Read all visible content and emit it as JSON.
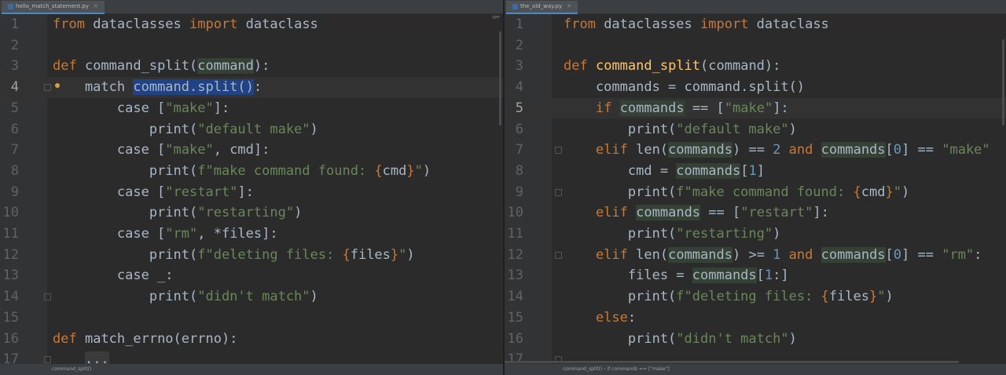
{
  "left": {
    "tab": "hello_match_statement.py",
    "off_label": "OFF",
    "breadcrumb": "command_split()",
    "lines": [
      {
        "n": "1",
        "html": "<span class=\"kw\">from</span> dataclasses <span class=\"kw\">import</span> dataclass"
      },
      {
        "n": "2",
        "html": ""
      },
      {
        "n": "3",
        "html": "<span class=\"kw\">def</span> command_split(<span class=\"hl\">command</span>):"
      },
      {
        "n": "4",
        "html": "    match <span class=\"sel\">command.split()</span>:"
      },
      {
        "n": "5",
        "html": "        case [<span class=\"str\">\"make\"</span>]:"
      },
      {
        "n": "6",
        "html": "            print(<span class=\"str\">\"default make\"</span>)"
      },
      {
        "n": "7",
        "html": "        case [<span class=\"str\">\"make\"</span>, cmd]:"
      },
      {
        "n": "8",
        "html": "            print(<span class=\"str\">f\"make command found: </span><span class=\"kw\">{</span>cmd<span class=\"kw\">}</span><span class=\"str\">\"</span>)"
      },
      {
        "n": "9",
        "html": "        case [<span class=\"str\">\"restart\"</span>]:"
      },
      {
        "n": "10",
        "html": "            print(<span class=\"str\">\"restarting\"</span>)"
      },
      {
        "n": "11",
        "html": "        case [<span class=\"str\">\"rm\"</span>, *files]:"
      },
      {
        "n": "12",
        "html": "            print(<span class=\"str\">f\"deleting files: </span><span class=\"kw\">{</span>files<span class=\"kw\">}</span><span class=\"str\">\"</span>)"
      },
      {
        "n": "13",
        "html": "        case _:"
      },
      {
        "n": "14",
        "html": "            print(<span class=\"str\">\"didn't match\"</span>)"
      },
      {
        "n": "15",
        "html": ""
      },
      {
        "n": "16",
        "html": "<span class=\"kw\">def</span> match_errno(errno):"
      },
      {
        "n": "17",
        "html": "    <span style=\"background:#3b3b3b\">...</span>"
      }
    ]
  },
  "right": {
    "tab": "the_old_way.py",
    "breadcrumb": "command_split()  ›  if commands == [\"make\"]",
    "lines": [
      {
        "n": "1",
        "html": "<span class=\"kw\">from</span> dataclasses <span class=\"kw\">import</span> dataclass"
      },
      {
        "n": "2",
        "html": ""
      },
      {
        "n": "3",
        "html": "<span class=\"kw\">def</span> <span class=\"fn\">command_split</span>(command):"
      },
      {
        "n": "4",
        "html": "    commands = command.split()"
      },
      {
        "n": "5",
        "html": "    <span class=\"kw\">if</span> <span class=\"hl\">commands</span> == [<span class=\"str\">\"make\"</span>]:"
      },
      {
        "n": "6",
        "html": "        print(<span class=\"str\">\"default make\"</span>)"
      },
      {
        "n": "7",
        "html": "    <span class=\"kw\">elif</span> len(<span class=\"hl\">commands</span>) == <span class=\"num-lit\">2</span> <span class=\"kw\">and</span> <span class=\"hl\">commands</span>[<span class=\"num-lit\">0</span>] == <span class=\"str\">\"make\"</span>"
      },
      {
        "n": "8",
        "html": "        cmd = <span class=\"hl\">commands</span>[<span class=\"num-lit\">1</span>]"
      },
      {
        "n": "9",
        "html": "        print(<span class=\"str\">f\"make command found: </span><span class=\"kw\">{</span>cmd<span class=\"kw\">}</span><span class=\"str\">\"</span>)"
      },
      {
        "n": "10",
        "html": "    <span class=\"kw\">elif</span> <span class=\"hl\">commands</span> == [<span class=\"str\">\"restart\"</span>]:"
      },
      {
        "n": "11",
        "html": "        print(<span class=\"str\">\"restarting\"</span>)"
      },
      {
        "n": "12",
        "html": "    <span class=\"kw\">elif</span> len(<span class=\"hl\">commands</span>) >= <span class=\"num-lit\">1</span> <span class=\"kw\">and</span> <span class=\"hl\">commands</span>[<span class=\"num-lit\">0</span>] == <span class=\"str\">\"rm\"</span>:"
      },
      {
        "n": "13",
        "html": "        files = <span class=\"hl\">commands</span>[<span class=\"num-lit\">1</span>:]"
      },
      {
        "n": "14",
        "html": "        print(<span class=\"str\">f\"deleting files: </span><span class=\"kw\">{</span>files<span class=\"kw\">}</span><span class=\"str\">\"</span>)"
      },
      {
        "n": "15",
        "html": "    <span class=\"kw\">else</span>:"
      },
      {
        "n": "16",
        "html": "        print(<span class=\"str\">\"didn't match\"</span>)"
      },
      {
        "n": "17",
        "html": ""
      }
    ]
  }
}
